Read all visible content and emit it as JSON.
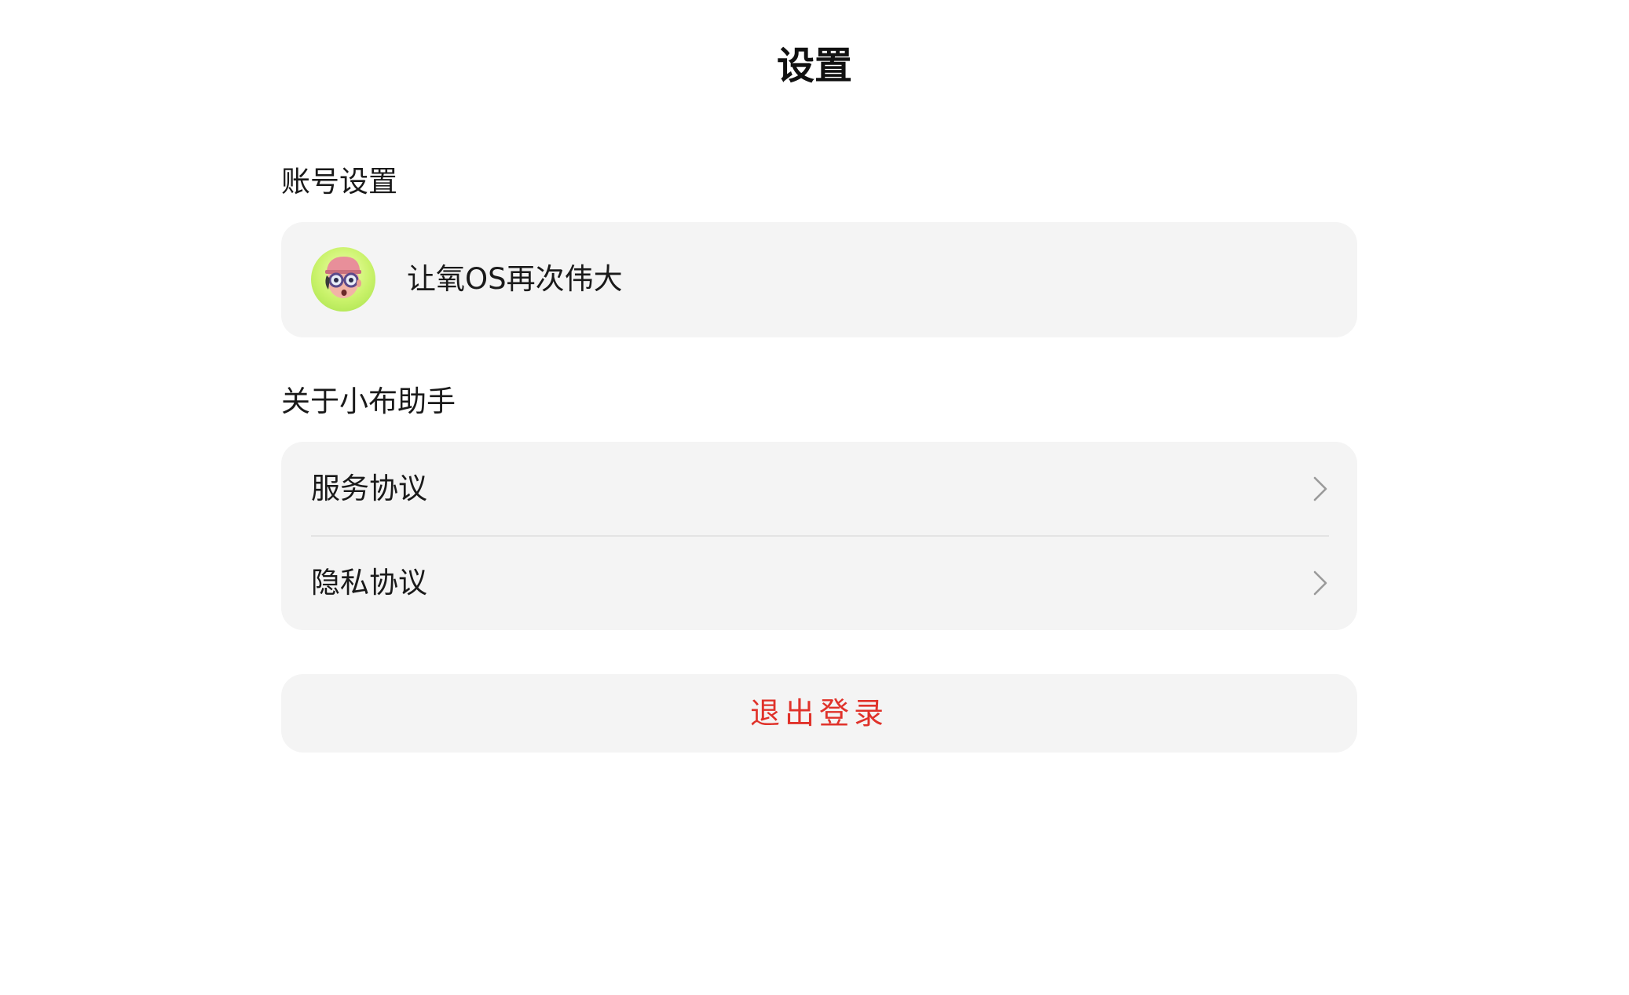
{
  "header": {
    "title": "设置"
  },
  "account_section": {
    "heading": "账号设置",
    "username": "让氧OS再次伟大",
    "avatar_icon": "cartoon-avatar-icon"
  },
  "about_section": {
    "heading": "关于小布助手",
    "items": [
      {
        "label": "服务协议",
        "icon": "chevron-right-icon"
      },
      {
        "label": "隐私协议",
        "icon": "chevron-right-icon"
      }
    ]
  },
  "logout": {
    "label": "退出登录"
  },
  "colors": {
    "background": "#ffffff",
    "card": "#f4f4f4",
    "logout_text": "#e0322a",
    "divider": "#e3e3e3",
    "chevron": "#9a9a9a"
  }
}
